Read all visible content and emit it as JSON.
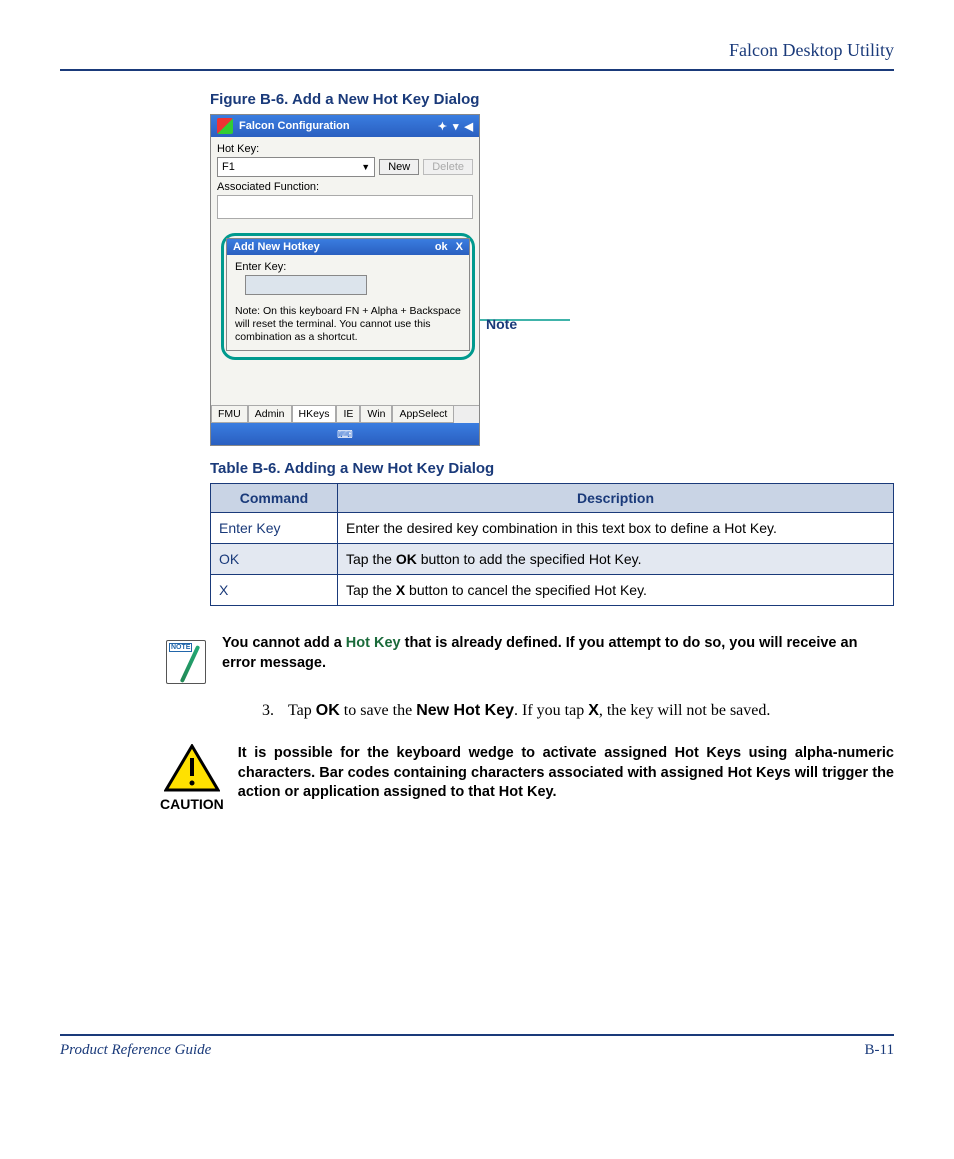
{
  "header": {
    "title": "Falcon Desktop Utility"
  },
  "figure": {
    "title": "Figure B-6. Add a New Hot Key Dialog",
    "callout_label": "Note"
  },
  "mock": {
    "window_title": "Falcon Configuration",
    "hotkey_label": "Hot Key:",
    "hotkey_value": "F1",
    "new_btn": "New",
    "delete_btn": "Delete",
    "assoc_label": "Associated Function:",
    "popup_title": "Add New Hotkey",
    "popup_ok": "ok",
    "popup_x": "X",
    "enter_key_label": "Enter Key:",
    "popup_note": "Note: On this keyboard FN + Alpha + Backspace will reset the terminal. You cannot use this combination as a shortcut.",
    "tabs": [
      "FMU",
      "Admin",
      "HKeys",
      "IE",
      "Win",
      "AppSelect"
    ],
    "keyboard_icon": "⌨"
  },
  "table": {
    "title": "Table B-6. Adding a New Hot Key Dialog",
    "headers": {
      "cmd": "Command",
      "desc": "Description"
    },
    "rows": [
      {
        "cmd": "Enter Key",
        "desc_pre": "Enter the desired key combination in this text box to define a Hot Key.",
        "bold": "",
        "desc_post": ""
      },
      {
        "cmd": "OK",
        "desc_pre": "Tap the ",
        "bold": "OK",
        "desc_post": " button to add the specified Hot Key."
      },
      {
        "cmd": "X",
        "desc_pre": "Tap the ",
        "bold": "X",
        "desc_post": " button to cancel the specified Hot Key."
      }
    ]
  },
  "note": {
    "text_pre": "You cannot add a ",
    "hotkey_term": "Hot Key",
    "text_post": " that is already defined. If you attempt to do so, you will receive an error message."
  },
  "step": {
    "num": "3.",
    "pre": "Tap ",
    "ok": "OK",
    "mid1": " to save the ",
    "nhk": "New Hot Key",
    "mid2": ". If you tap ",
    "x": "X",
    "post": ", the key will not be saved."
  },
  "caution": {
    "label": "CAUTION",
    "text": "It is possible for the keyboard wedge to activate assigned Hot Keys using alpha-numeric characters. Bar codes containing characters associated with assigned Hot Keys will trigger the action or application assigned to that Hot Key."
  },
  "footer": {
    "left": "Product Reference Guide",
    "right": "B-11"
  }
}
